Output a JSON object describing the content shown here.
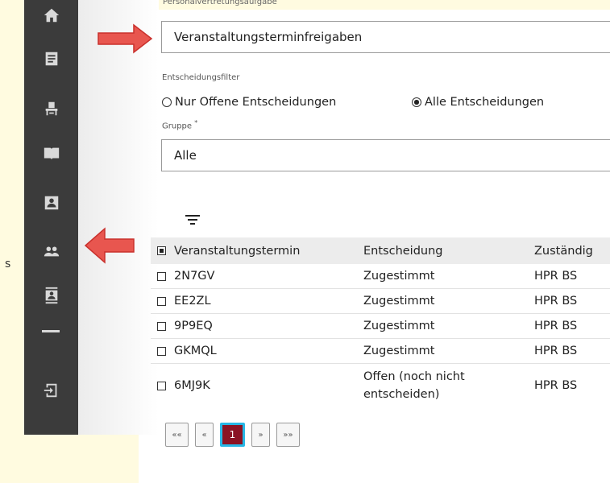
{
  "top_field_label": "Personalvertretungsaufgabe",
  "top_field_value": "Veranstaltungsterminfreigaben",
  "filter": {
    "label": "Entscheidungsfilter",
    "options": [
      "Nur Offene Entscheidungen",
      "Alle Entscheidungen"
    ],
    "selected": "Alle Entscheidungen"
  },
  "group": {
    "label": "Gruppe",
    "required_mark": "*",
    "value": "Alle"
  },
  "table": {
    "columns": [
      "Veranstaltungstermin",
      "Entscheidung",
      "Zuständig"
    ],
    "rows": [
      {
        "termin": "2N7GV",
        "entscheidung": "Zugestimmt",
        "zustaendig": "HPR BS"
      },
      {
        "termin": "EE2ZL",
        "entscheidung": "Zugestimmt",
        "zustaendig": "HPR BS"
      },
      {
        "termin": "9P9EQ",
        "entscheidung": "Zugestimmt",
        "zustaendig": "HPR BS"
      },
      {
        "termin": "GKMQL",
        "entscheidung": "Zugestimmt",
        "zustaendig": "HPR BS"
      },
      {
        "termin": "6MJ9K",
        "entscheidung": "Offen (noch nicht entscheiden)",
        "zustaendig": "HPR BS"
      }
    ]
  },
  "pager": {
    "first": "««",
    "prev": "«",
    "current": "1",
    "next": "»",
    "last": "»»"
  },
  "sidebar_icons": [
    "home-icon",
    "news-icon",
    "seat-icon",
    "book-icon",
    "contact-card-icon",
    "people-icon",
    "contacts-list-icon",
    "logout-icon"
  ],
  "colors": {
    "sidebar": "#3b3b3b",
    "pager_active": "#8a1324",
    "pager_active_border": "#27b7e6",
    "annotation_arrow": "#e8564f"
  },
  "cut_off_char": "s"
}
